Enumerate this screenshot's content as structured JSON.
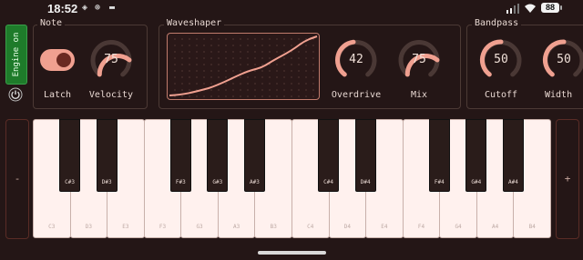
{
  "status_bar": {
    "time": "18:52",
    "battery": "88"
  },
  "engine": {
    "label": "Engine on"
  },
  "note_panel": {
    "title": "Note",
    "latch_label": "Latch",
    "velocity": {
      "value": "75",
      "label": "Velocity"
    }
  },
  "waveshaper_panel": {
    "title": "Waveshaper",
    "overdrive": {
      "value": "42",
      "label": "Overdrive"
    },
    "mix": {
      "value": "75",
      "label": "Mix"
    }
  },
  "bandpass_panel": {
    "title": "Bandpass",
    "cutoff": {
      "value": "50",
      "label": "Cutoff"
    },
    "width": {
      "value": "50",
      "label": "Width"
    }
  },
  "keyboard": {
    "octave_down_label": "-",
    "octave_up_label": "+",
    "white_keys": [
      "C3",
      "D3",
      "E3",
      "F3",
      "G3",
      "A3",
      "B3",
      "C4",
      "D4",
      "E4",
      "F4",
      "G4",
      "A4",
      "B4"
    ],
    "black_keys": [
      "C#3",
      "D#3",
      "F#3",
      "G#3",
      "A#3",
      "C#4",
      "D#4",
      "F#4",
      "G#4",
      "A#4"
    ]
  },
  "colors": {
    "accent": "#f0a090",
    "engine_on": "#1e7b2a",
    "background": "#241616"
  },
  "icons": [
    "power-icon",
    "wifi-icon",
    "cellular-icon"
  ]
}
